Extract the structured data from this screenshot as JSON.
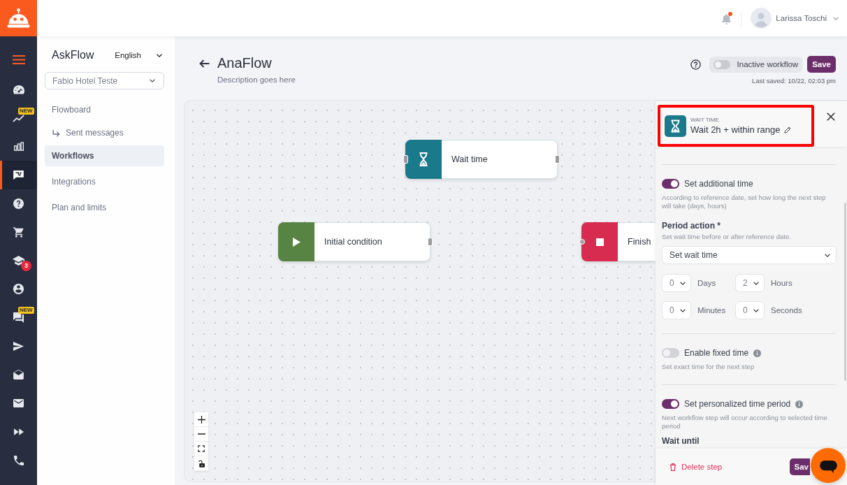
{
  "rail": {
    "items": [
      {
        "selected": false
      },
      {
        "selected": false,
        "badge": {
          "kind": "tag",
          "text": "NEW"
        }
      },
      {
        "selected": false
      },
      {
        "selected": true
      },
      {
        "selected": false
      },
      {
        "selected": false
      },
      {
        "selected": false,
        "badge": {
          "kind": "count",
          "text": "3"
        }
      },
      {
        "selected": false
      },
      {
        "selected": false,
        "badge": {
          "kind": "tag",
          "text": "NEW"
        }
      },
      {
        "selected": false
      },
      {
        "selected": false
      },
      {
        "selected": false
      },
      {
        "selected": false
      },
      {
        "selected": false
      }
    ]
  },
  "top_bar": {
    "notifications": {
      "unread": true
    },
    "user_name": "Larissa Toschi"
  },
  "sidebar": {
    "title": "AskFlow",
    "language": "English",
    "account": "Fabio Hotel Teste",
    "items": [
      {
        "label": "Flowboard",
        "selected": false,
        "children": [
          {
            "label": "Sent messages",
            "selected": false
          }
        ]
      },
      {
        "label": "Workflows",
        "selected": true
      },
      {
        "label": "Integrations",
        "selected": false
      },
      {
        "label": "Plan and limits",
        "selected": false
      }
    ]
  },
  "page": {
    "title": "AnaFlow",
    "description": "Description goes here",
    "status_toggle": {
      "label": "Inactive workflow",
      "on": false
    },
    "save_label": "Save",
    "last_saved": "Last saved: 10/22, 02:03 pm"
  },
  "canvas": {
    "nodes": [
      {
        "kind": "wait",
        "label": "Wait time",
        "color": "#1a798b"
      },
      {
        "kind": "start",
        "label": "Initial condition",
        "color": "#578443"
      },
      {
        "kind": "finish",
        "label": "Finish",
        "color": "#d72b4f"
      }
    ]
  },
  "panel": {
    "step_type": "WAIT TIME",
    "title": "Wait 2h + within range",
    "highlighted": true,
    "sections": [
      {
        "items": [
          {
            "kind": "toggle",
            "label": "Set additional time",
            "on": true,
            "hint": "According to reference date, set how long the next step will take (days, hours)"
          },
          {
            "kind": "select",
            "label": "Period action *",
            "hint": "Set wait time before or after reference date.",
            "value": "Set wait time"
          },
          {
            "kind": "durations",
            "fields": [
              {
                "value": "0",
                "unit": "Days"
              },
              {
                "value": "2",
                "unit": "Hours"
              },
              {
                "value": "0",
                "unit": "Minutes"
              },
              {
                "value": "0",
                "unit": "Seconds"
              }
            ]
          }
        ]
      },
      {
        "items": [
          {
            "kind": "toggle",
            "label": "Enable fixed time",
            "on": false,
            "info": true,
            "hint": "Set exact time for the next step"
          }
        ]
      },
      {
        "items": [
          {
            "kind": "toggle",
            "label": "Set personalized time period",
            "on": true,
            "info": true,
            "hint": "Next workflow step will occur according to selected time period"
          },
          {
            "kind": "label",
            "text": "Wait until"
          }
        ]
      }
    ],
    "footer": {
      "delete_label": "Delete step",
      "save_label": "Sav"
    }
  }
}
